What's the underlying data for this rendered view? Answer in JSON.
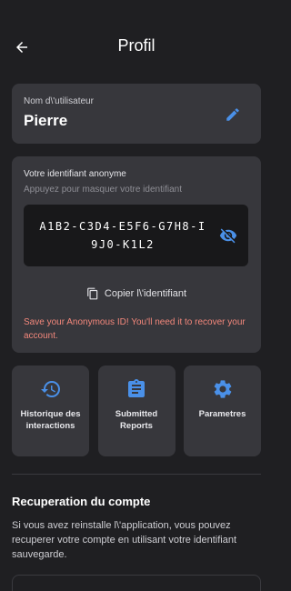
{
  "header": {
    "title": "Profil",
    "back_icon": "arrow-left-icon"
  },
  "user": {
    "label": "Nom d\\'utilisateur",
    "name": "Pierre",
    "edit_icon": "pencil-icon"
  },
  "anonymous_id": {
    "title": "Votre identifiant anonyme",
    "hint": "Appuyez pour masquer votre identifiant",
    "value": "A1B2-C3D4-E5F6-G7H8-I9J0-K1L2",
    "visibility_icon": "eye-off-icon",
    "copy_label": "Copier l\\'identifiant",
    "copy_icon": "copy-icon",
    "warning": "Save your Anonymous ID! You'll need it to recover your account."
  },
  "tiles": [
    {
      "label": "Historique des interactions",
      "icon": "history-icon"
    },
    {
      "label": "Submitted Reports",
      "icon": "clipboard-icon"
    },
    {
      "label": "Parametres",
      "icon": "gear-icon"
    }
  ],
  "recovery": {
    "title": "Recuperation du compte",
    "text": "Si vous avez reinstalle l\\'application, vous pouvez recuperer votre compte en utilisant votre identifiant sauvegarde."
  },
  "colors": {
    "background": "#1f1f22",
    "card": "#37373c",
    "accent": "#4a90e8",
    "warning": "#f2877b"
  }
}
